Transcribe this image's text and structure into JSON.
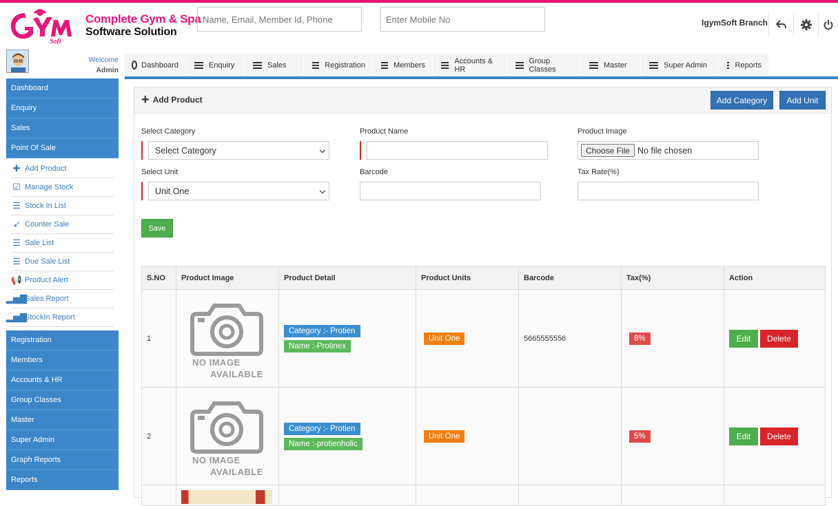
{
  "header": {
    "brand_line1": "Complete Gym & Spa",
    "brand_line2": "Software Solution",
    "search_placeholder": "Name, Email, Member Id, Phone",
    "mobile_placeholder": "Enter Mobile No",
    "branch": "IgymSoft Branch",
    "accent_color": "#e8177a"
  },
  "user": {
    "welcome": "Welcome",
    "name": "Admin"
  },
  "topnav": [
    "Dashboard",
    "Enquiry",
    "Sales",
    "Registration",
    "Members",
    "Accounts & HR",
    "Group Classes",
    "Master",
    "Super Admin",
    "Reports"
  ],
  "sidebar": {
    "top": [
      "Dashboard",
      "Enquiry",
      "Sales",
      "Point Of Sale"
    ],
    "sub": [
      {
        "label": "Add Product",
        "icon": "plus-icon"
      },
      {
        "label": "Manage Stock",
        "icon": "checklist-icon"
      },
      {
        "label": "Stock In List",
        "icon": "list-icon"
      },
      {
        "label": "Counter Sale",
        "icon": "rocket-icon"
      },
      {
        "label": "Sale List",
        "icon": "list-icon"
      },
      {
        "label": "Due Sale List",
        "icon": "list-icon"
      },
      {
        "label": "Product Alert",
        "icon": "megaphone-icon"
      },
      {
        "label": "Sales Report",
        "icon": "bar-chart-icon"
      },
      {
        "label": "StockIn Report",
        "icon": "bar-chart-icon"
      }
    ],
    "bottom": [
      "Registration",
      "Members",
      "Accounts & HR",
      "Group Classes",
      "Master",
      "Super Admin",
      "Graph Reports",
      "Reports"
    ]
  },
  "panel": {
    "title": "Add Product",
    "add_category": "Add Category",
    "add_unit": "Add Unit"
  },
  "form": {
    "category_label": "Select Category",
    "category_value": "Select Category",
    "product_name_label": "Product Name",
    "product_name_value": "",
    "image_label": "Product Image",
    "choose_file": "Choose File",
    "no_file": "No file chosen",
    "unit_label": "Select Unit",
    "unit_value": "Unit One",
    "barcode_label": "Barcode",
    "barcode_value": "",
    "tax_label": "Tax Rate(%)",
    "tax_value": "",
    "save": "Save"
  },
  "table": {
    "columns": [
      "S.NO",
      "Product Image",
      "Product Detail",
      "Product Units",
      "Barcode",
      "Tax(%)",
      "Action"
    ],
    "no_image_line1": "NO IMAGE",
    "no_image_line2": "AVAILABLE",
    "rows": [
      {
        "sno": "1",
        "category": "Category :- Protien",
        "name": "Name :-Protinex",
        "unit": "Unit One",
        "barcode": "5665555556",
        "tax": "8%",
        "edit": "Edit",
        "delete": "Delete"
      },
      {
        "sno": "2",
        "category": "Category :- Protien",
        "name": "Name :-protienholic",
        "unit": "Unit One",
        "barcode": "",
        "tax": "5%",
        "edit": "Edit",
        "delete": "Delete"
      }
    ]
  }
}
